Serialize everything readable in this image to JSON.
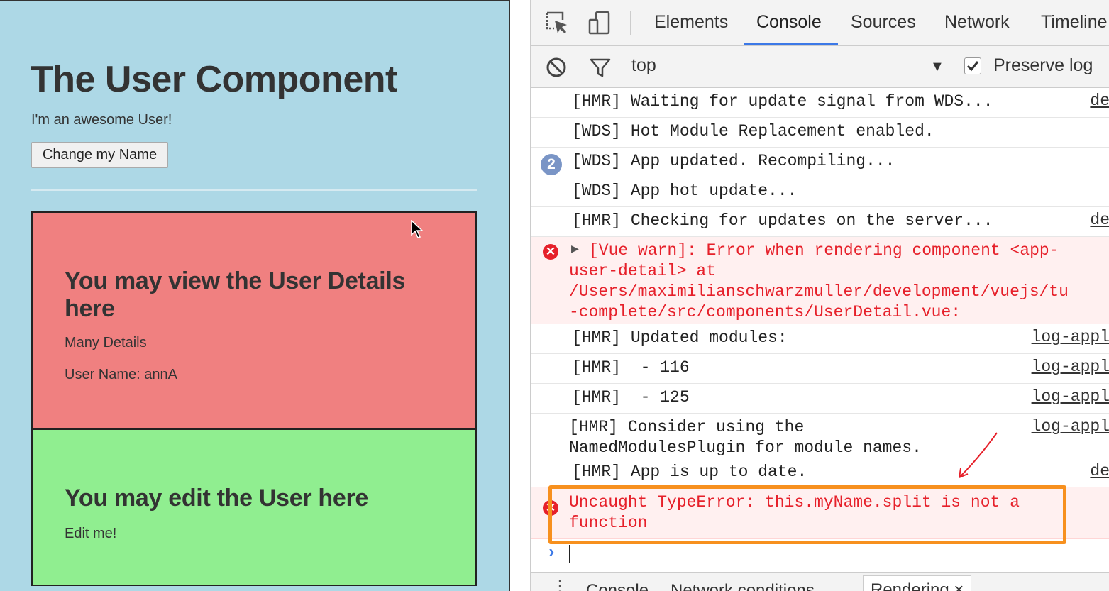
{
  "app": {
    "title": "The User Component",
    "subtitle": "I'm an awesome User!",
    "change_name_button": "Change my Name",
    "detail": {
      "heading": "You may view the User Details here",
      "text_1": "Many Details",
      "text_2": "User Name: annA"
    },
    "edit": {
      "heading": "You may edit the User here",
      "text": "Edit me!"
    }
  },
  "devtools": {
    "tabs": [
      "Elements",
      "Console",
      "Sources",
      "Network",
      "Timeline"
    ],
    "active_tab": "Console",
    "toolbar": {
      "context": "top",
      "preserve_log_label": "Preserve log",
      "preserve_log_checked": true
    },
    "messages": [
      {
        "text": "[HMR] Waiting for update signal from WDS...",
        "source": "de"
      },
      {
        "text": "[WDS] Hot Module Replacement enabled.",
        "source": ""
      },
      {
        "text": "[WDS] App updated. Recompiling...",
        "source": "",
        "count": "2"
      },
      {
        "text": "[WDS] App hot update...",
        "source": ""
      },
      {
        "text": "[HMR] Checking for updates on the server...",
        "source": "de"
      },
      {
        "text": "[Vue warn]: Error when rendering component <app-\nuser-detail> at\n/Users/maximilianschwarzmuller/development/vuejs/tu\n-complete/src/components/UserDetail.vue:",
        "source": "",
        "level": "error"
      },
      {
        "text": "[HMR] Updated modules:",
        "source": "log-appl"
      },
      {
        "text": "[HMR]  - 116",
        "source": "log-appl"
      },
      {
        "text": "[HMR]  - 125",
        "source": "log-appl"
      },
      {
        "text": "[HMR] Consider using the\nNamedModulesPlugin for module names.",
        "source": "log-appl"
      },
      {
        "text": "[HMR] App is up to date.",
        "source": "de"
      },
      {
        "text": "Uncaught TypeError: this.myName.split is not a\nfunction",
        "source": "",
        "level": "error"
      }
    ],
    "drawer_tabs": [
      "Console",
      "Network conditions",
      "Rendering ×"
    ]
  },
  "colors": {
    "app_background": "#add8e6",
    "detail_background": "#f08080",
    "edit_background": "#90ee90",
    "error_red": "#e6202a",
    "accent_blue": "#3b78e7",
    "annotation_orange": "#f7901e"
  }
}
